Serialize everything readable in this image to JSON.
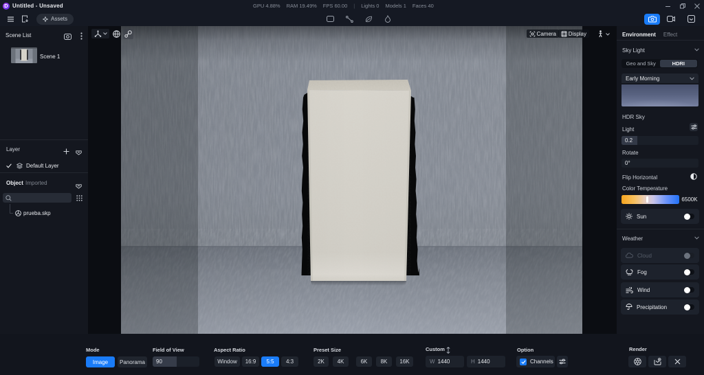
{
  "titlebar": {
    "title": "Untitled - Unsaved",
    "stats": {
      "gpu": "GPU 4.88%",
      "ram": "RAM 19.49%",
      "fps": "FPS 60.00",
      "separator": "|",
      "lights": "Lights 0",
      "models": "Models 1",
      "faces": "Faces 40"
    }
  },
  "toolbar": {
    "assets_label": "Assets"
  },
  "scene_list": {
    "title": "Scene List",
    "scenes": [
      {
        "name": "Scene 1"
      }
    ]
  },
  "layer_panel": {
    "title": "Layer",
    "layers": [
      {
        "name": "Default Layer"
      }
    ]
  },
  "object_panel": {
    "title": "Object",
    "subtitle": "Imported",
    "items": [
      {
        "name": "prueba.skp"
      }
    ]
  },
  "viewport": {
    "camera_label": "Camera",
    "display_label": "Display"
  },
  "environment": {
    "tabs": {
      "environment": "Environment",
      "effect": "Effect"
    },
    "sky_light": {
      "title": "Sky Light",
      "mode_options": {
        "geo": "Geo and Sky",
        "hdri": "HDRI"
      },
      "selected_mode": "HDRI",
      "preset": "Early Morning",
      "hdr_sky_label": "HDR Sky",
      "light_label": "Light",
      "light_value": "0.2",
      "rotate_label": "Rotate",
      "rotate_value": "0°",
      "flip_label": "Flip Horizontal",
      "color_temp_label": "Color Temperature",
      "color_temp_value": "6500K",
      "sun_label": "Sun"
    },
    "weather": {
      "title": "Weather",
      "rows": [
        {
          "label": "Cloud",
          "disabled": true,
          "on": false
        },
        {
          "label": "Fog",
          "disabled": false,
          "on": false
        },
        {
          "label": "Wind",
          "disabled": false,
          "on": false
        },
        {
          "label": "Precipitation",
          "disabled": false,
          "on": false
        }
      ]
    }
  },
  "render_bar": {
    "mode": {
      "label": "Mode",
      "options": {
        "image": "Image",
        "panorama": "Panorama"
      },
      "selected": "Image"
    },
    "fov": {
      "label": "Field of View",
      "value": "90"
    },
    "aspect": {
      "label": "Aspect Ratio",
      "options": {
        "window": "Window",
        "r169": "16:9",
        "r55": "5:5",
        "r43": "4:3"
      },
      "selected": "5:5"
    },
    "preset": {
      "label": "Preset Size",
      "options": {
        "k2": "2K",
        "k4": "4K",
        "k6": "6K",
        "k8": "8K",
        "k16": "16K"
      }
    },
    "custom": {
      "label": "Custom",
      "w_prefix": "W",
      "w_value": "1440",
      "h_prefix": "H",
      "h_value": "1440"
    },
    "option": {
      "label": "Option",
      "checkbox_label": "Channels",
      "checked": true
    },
    "render": {
      "label": "Render"
    }
  },
  "colors": {
    "accent": "#1a7cf8"
  }
}
